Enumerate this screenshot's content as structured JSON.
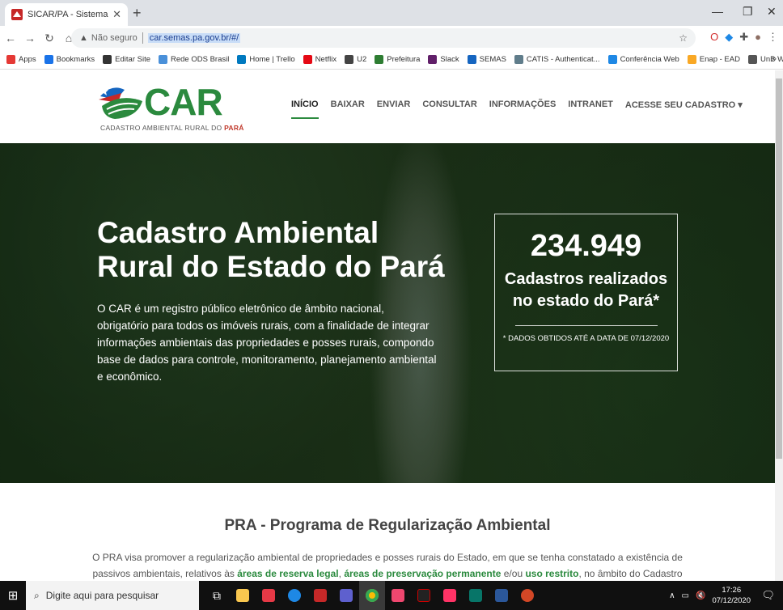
{
  "browser": {
    "tab_title": "SICAR/PA - Sistema de Cadastro",
    "tab_close": "✕",
    "new_tab": "+",
    "security_label": "Não seguro",
    "url": "car.semas.pa.gov.br/#/",
    "win_minimize": "—",
    "win_restore": "❐",
    "win_close": "✕"
  },
  "bookmarks": [
    {
      "label": "Apps",
      "color": "#e53935"
    },
    {
      "label": "Bookmarks",
      "color": "#1a73e8"
    },
    {
      "label": "Editar Site",
      "color": "#333333"
    },
    {
      "label": "Rede ODS Brasil",
      "color": "#4a90d9"
    },
    {
      "label": "Home | Trello",
      "color": "#0079bf"
    },
    {
      "label": "Netflix",
      "color": "#e50914"
    },
    {
      "label": "U2",
      "color": "#444444"
    },
    {
      "label": "Prefeitura",
      "color": "#2e7d32"
    },
    {
      "label": "Slack",
      "color": "#611f69"
    },
    {
      "label": "SEMAS",
      "color": "#1565c0"
    },
    {
      "label": "CATIS - Authenticat...",
      "color": "#607d8b"
    },
    {
      "label": "Conferência Web",
      "color": "#1e88e5"
    },
    {
      "label": "Enap - EAD",
      "color": "#f9a825"
    },
    {
      "label": "UnB Webmail Aluno",
      "color": "#555555"
    }
  ],
  "bookmarks_more": "»",
  "site": {
    "logo_word": "CAR",
    "logo_tagline": "CADASTRO AMBIENTAL RURAL DO",
    "logo_tagline_state": "PARÁ",
    "nav": [
      {
        "label": "INÍCIO"
      },
      {
        "label": "BAIXAR"
      },
      {
        "label": "ENVIAR"
      },
      {
        "label": "CONSULTAR"
      },
      {
        "label": "INFORMAÇÕES"
      },
      {
        "label": "INTRANET"
      },
      {
        "label": "ACESSE SEU CADASTRO ▾"
      }
    ]
  },
  "hero": {
    "title": "Cadastro Ambiental Rural do Estado do Pará",
    "description": "O CAR é um registro público eletrônico de âmbito nacional, obrigatório para todos os imóveis rurais, com a finalidade de integrar informações ambientais das propriedades e posses rurais, compondo base de dados para controle, monitoramento, planejamento ambiental e econômico.",
    "stat_number": "234.949",
    "stat_label": "Cadastros realizados no estado do Pará*",
    "stat_note": "* DADOS OBTIDOS ATÉ A DATA DE 07/12/2020"
  },
  "pra": {
    "title": "PRA - Programa de Regularização Ambiental",
    "text_1": "O PRA visa promover a regularização ambiental de propriedades e posses rurais do Estado, em que se tenha constatado a existência de passivos ambientais, relativos às ",
    "bold_1": "áreas de reserva legal",
    "text_2": ", ",
    "bold_2": "áreas de preservação permanente",
    "text_3": " e/ou ",
    "bold_3": "uso restrito",
    "text_4": ", no âmbito do Cadastro Ambiental Rural."
  },
  "taskbar": {
    "search_placeholder": "Digite aqui para pesquisar",
    "time": "17:26",
    "date": "07/12/2020",
    "tray_arrow": "∧",
    "tray_volume": "🔇"
  }
}
